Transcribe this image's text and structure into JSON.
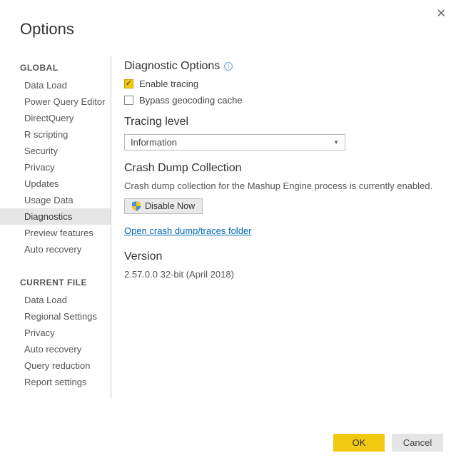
{
  "title": "Options",
  "close_label": "✕",
  "sidebar": {
    "section_global": "GLOBAL",
    "section_current": "CURRENT FILE",
    "global_items": [
      "Data Load",
      "Power Query Editor",
      "DirectQuery",
      "R scripting",
      "Security",
      "Privacy",
      "Updates",
      "Usage Data",
      "Diagnostics",
      "Preview features",
      "Auto recovery"
    ],
    "global_selected_index": 8,
    "current_items": [
      "Data Load",
      "Regional Settings",
      "Privacy",
      "Auto recovery",
      "Query reduction",
      "Report settings"
    ]
  },
  "diagnostic": {
    "heading": "Diagnostic Options",
    "enable_tracing": {
      "label": "Enable tracing",
      "checked": true
    },
    "bypass_geocoding": {
      "label": "Bypass geocoding cache",
      "checked": false
    }
  },
  "tracing": {
    "heading": "Tracing level",
    "selected": "Information"
  },
  "crash": {
    "heading": "Crash Dump Collection",
    "description": "Crash dump collection for the Mashup Engine process is currently enabled.",
    "disable_label": "Disable Now",
    "link_label": "Open crash dump/traces folder"
  },
  "version": {
    "heading": "Version",
    "value": "2.57.0.0 32-bit (April 2018)"
  },
  "footer": {
    "ok": "OK",
    "cancel": "Cancel"
  }
}
